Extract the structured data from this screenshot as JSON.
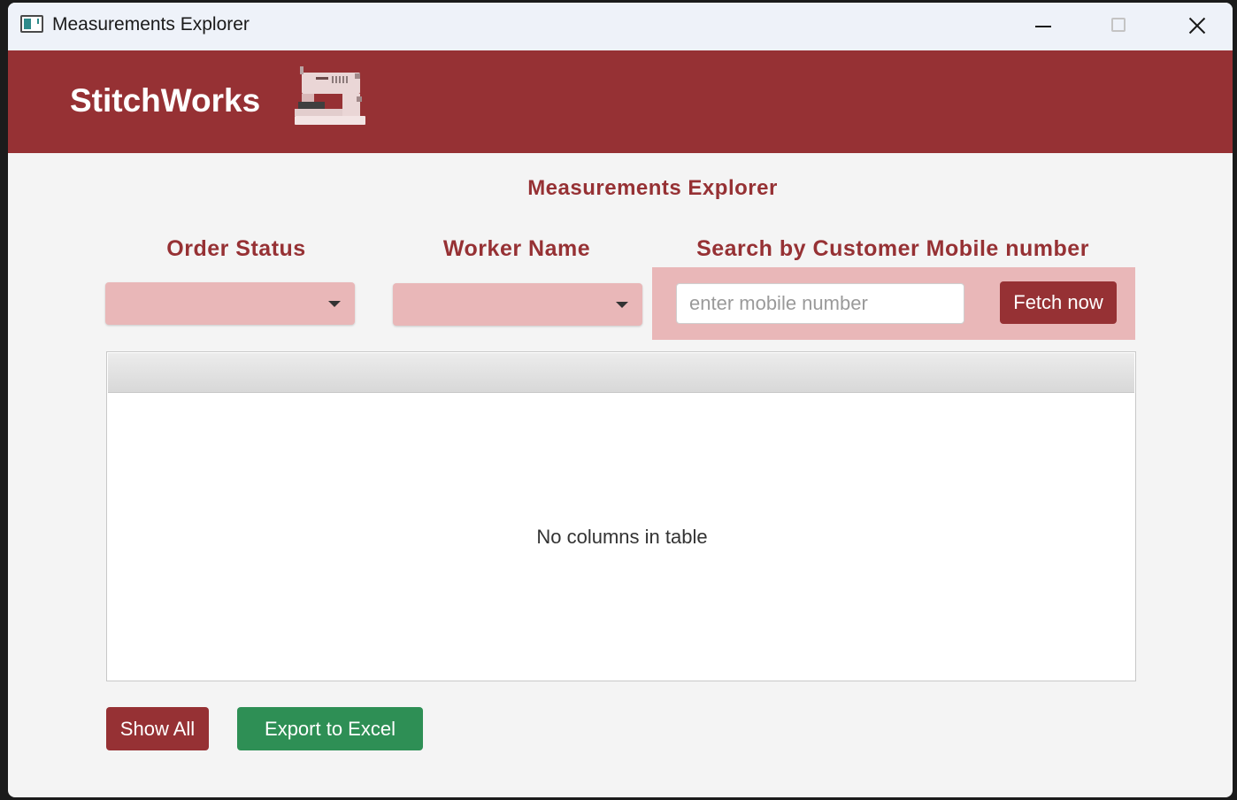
{
  "window": {
    "title": "Measurements Explorer",
    "controls": [
      "minimize-icon",
      "maximize-icon",
      "close-icon"
    ]
  },
  "header": {
    "brand": "StitchWorks",
    "logo_icon": "sewing-machine-icon",
    "background": "#963134"
  },
  "page": {
    "title": "Measurements Explorer"
  },
  "filters": {
    "order_status": {
      "label": "Order Status",
      "selected": ""
    },
    "worker_name": {
      "label": "Worker Name",
      "selected": ""
    },
    "search": {
      "label": "Search by Customer Mobile number",
      "placeholder": "enter mobile number",
      "value": "",
      "button_label": "Fetch now"
    }
  },
  "table": {
    "columns": [],
    "rows": [],
    "empty_message": "No columns in table"
  },
  "actions": {
    "show_all_label": "Show All",
    "export_label": "Export to Excel"
  },
  "colors": {
    "primary": "#963134",
    "accent_light": "#e9b7b8",
    "export_green": "#2e8f55"
  }
}
